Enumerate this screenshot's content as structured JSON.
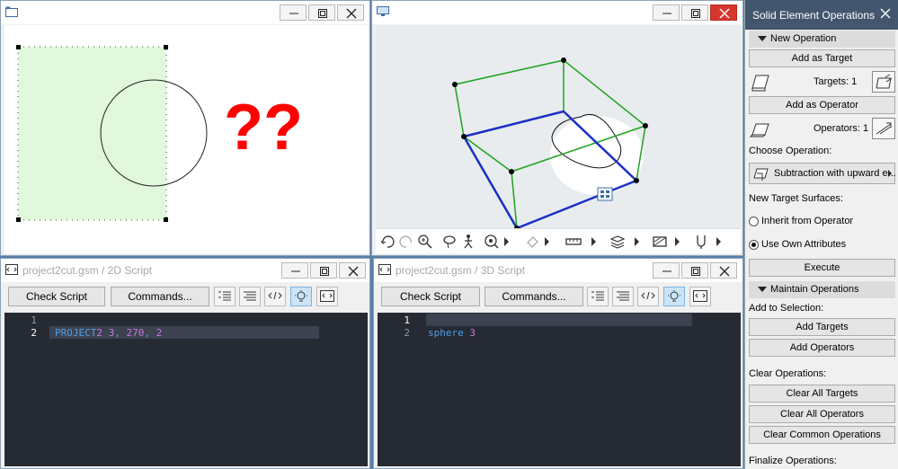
{
  "view2d": {
    "overlay_text": "??"
  },
  "script2d": {
    "title": "project2cut.gsm / 2D Script",
    "check_label": "Check Script",
    "commands_label": "Commands...",
    "lines": [
      {
        "num": "1",
        "text": ""
      },
      {
        "num": "2",
        "text": "PROJECT2 3, 270, 2"
      }
    ]
  },
  "script3d": {
    "title": "project2cut.gsm / 3D Script",
    "check_label": "Check Script",
    "commands_label": "Commands...",
    "lines": [
      {
        "num": "1",
        "text": ""
      },
      {
        "num": "2",
        "text": "sphere 3"
      }
    ]
  },
  "panel": {
    "title": "Solid Element Operations",
    "new_operation": "New Operation",
    "add_as_target": "Add as Target",
    "targets": "Targets: 1",
    "add_as_operator": "Add as Operator",
    "operators": "Operators: 1",
    "choose_operation": "Choose Operation:",
    "operation_selected": "Subtraction with upward e...",
    "new_target_surfaces": "New Target Surfaces:",
    "inherit": "Inherit from Operator",
    "use_own": "Use Own Attributes",
    "execute": "Execute",
    "maintain_operations": "Maintain Operations",
    "add_to_selection": "Add to Selection:",
    "add_targets": "Add Targets",
    "add_operators": "Add Operators",
    "clear_operations": "Clear Operations:",
    "clear_all_targets": "Clear All Targets",
    "clear_all_operators": "Clear All Operators",
    "clear_common": "Clear Common Operations",
    "finalize": "Finalize Operations:"
  },
  "colors": {
    "panel_title_bg": "#43566e",
    "code_bg": "#262a33",
    "keyword": "#4ea0e8",
    "number": "#c678dd",
    "question_marks": "#ff0000"
  }
}
